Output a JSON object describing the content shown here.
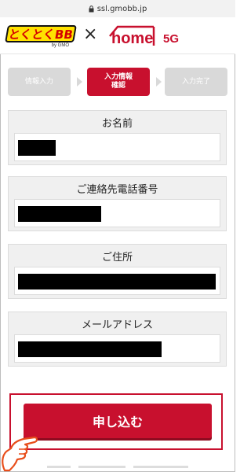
{
  "browser": {
    "url": "ssl.gmobb.jp"
  },
  "header": {
    "left_logo_text": "とくとくBB",
    "left_logo_sub": "by GMO",
    "separator": "×",
    "right_logo_text": "home",
    "right_logo_suffix": "5G"
  },
  "steps": [
    {
      "label": "情報入力",
      "state": "inactive"
    },
    {
      "label": "入力情報\n確認",
      "state": "active"
    },
    {
      "label": "入力完了",
      "state": "inactive"
    }
  ],
  "fields": [
    {
      "label": "お名前",
      "value": ""
    },
    {
      "label": "ご連絡先電話番号",
      "value": ""
    },
    {
      "label": "ご住所",
      "value": ""
    },
    {
      "label": "メールアドレス",
      "value": ""
    }
  ],
  "submit": {
    "label": "申し込む"
  },
  "colors": {
    "accent": "#c8102e",
    "inactive_step": "#d9d9d9",
    "card_bg": "#f0f0f0"
  }
}
